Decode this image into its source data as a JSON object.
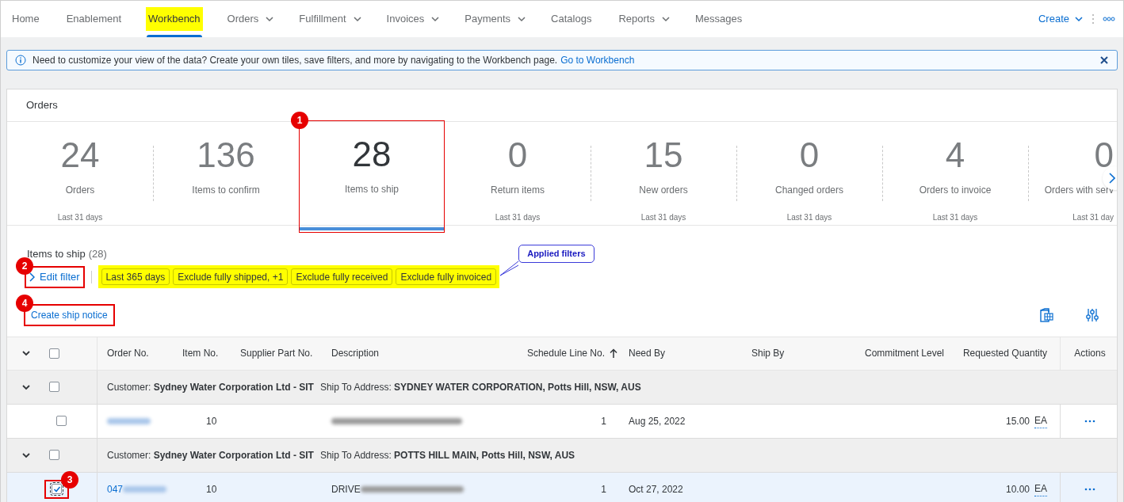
{
  "nav": {
    "tabs": [
      {
        "label": "Home",
        "selected": false,
        "dropdown": false
      },
      {
        "label": "Enablement",
        "selected": false,
        "dropdown": false
      },
      {
        "label": "Workbench",
        "selected": true,
        "dropdown": false,
        "highlighted": true
      },
      {
        "label": "Orders",
        "selected": false,
        "dropdown": true
      },
      {
        "label": "Fulfillment",
        "selected": false,
        "dropdown": true
      },
      {
        "label": "Invoices",
        "selected": false,
        "dropdown": true
      },
      {
        "label": "Payments",
        "selected": false,
        "dropdown": true
      },
      {
        "label": "Catalogs",
        "selected": false,
        "dropdown": false
      },
      {
        "label": "Reports",
        "selected": false,
        "dropdown": true
      },
      {
        "label": "Messages",
        "selected": false,
        "dropdown": false
      }
    ],
    "create": "Create"
  },
  "banner": {
    "text": "Need to customize your view of the data? Create your own tiles, save filters, and more by navigating to the Workbench page.",
    "link": "Go to Workbench"
  },
  "orders": {
    "title": "Orders",
    "tiles": [
      {
        "value": "24",
        "label": "Orders",
        "period": "Last 31 days",
        "selected": false
      },
      {
        "value": "136",
        "label": "Items to confirm",
        "selected": false
      },
      {
        "value": "28",
        "label": "Items to ship",
        "selected": true,
        "marker": "1"
      },
      {
        "value": "0",
        "label": "Return items",
        "period": "Last 31 days",
        "selected": false
      },
      {
        "value": "15",
        "label": "New orders",
        "period": "Last 31 days",
        "selected": false
      },
      {
        "value": "0",
        "label": "Changed orders",
        "period": "Last 31 days",
        "selected": false
      },
      {
        "value": "4",
        "label": "Orders to invoice",
        "period": "Last 31 days",
        "selected": false
      },
      {
        "value": "0",
        "label": "Orders with serv",
        "period": "Last 31 day",
        "selected": false
      }
    ]
  },
  "list": {
    "title": "Items to ship",
    "count": "(28)",
    "edit_filter": {
      "label": "Edit filter",
      "marker": "2"
    },
    "filters": {
      "highlighted": true,
      "chips": [
        "Last 365 days",
        "Exclude fully shipped, +1",
        "Exclude fully received",
        "Exclude fully invoiced"
      ]
    },
    "callout": "Applied filters",
    "create_button": {
      "label": "Create ship notice",
      "marker": "4"
    }
  },
  "table": {
    "all_checked": false,
    "columns": [
      {
        "label": "Order No.",
        "sorted": false
      },
      {
        "label": "Item No.",
        "sorted": false
      },
      {
        "label": "Supplier Part No.",
        "sorted": false
      },
      {
        "label": "Description",
        "sorted": false
      },
      {
        "label": "Schedule Line No.",
        "sorted": true
      },
      {
        "label": "Need By",
        "sorted": false
      },
      {
        "label": "Ship By",
        "sorted": false
      },
      {
        "label": "Commitment Level",
        "sorted": false
      },
      {
        "label": "Requested Quantity",
        "sorted": false
      },
      {
        "label": "Actions",
        "sorted": false
      }
    ],
    "groups": [
      {
        "customer_label": "Customer:",
        "customer": "Sydney Water Corporation Ltd - SIT",
        "address_label": "Ship To Address:",
        "address": "SYDNEY WATER CORPORATION, Potts Hill, NSW, AUS",
        "checked": false,
        "rows": [
          {
            "blurred": true,
            "item_no": "10",
            "desc_blurred": true,
            "schedule_line": "1",
            "need_by": "Aug 25, 2022",
            "quantity": "15.00",
            "unit": "EA",
            "checked": false
          }
        ]
      },
      {
        "customer_label": "Customer:",
        "customer": "Sydney Water Corporation Ltd - SIT",
        "address_label": "Ship To Address:",
        "address": "POTTS HILL MAIN, Potts Hill, NSW, AUS",
        "checked": false,
        "rows": [
          {
            "order_no": "047",
            "blurred": true,
            "item_no": "10",
            "description": "DRIVE",
            "desc_blurred": true,
            "schedule_line": "1",
            "need_by": "Oct 27, 2022",
            "quantity": "10.00",
            "unit": "EA",
            "checked": true,
            "marker": "3"
          }
        ]
      }
    ]
  }
}
